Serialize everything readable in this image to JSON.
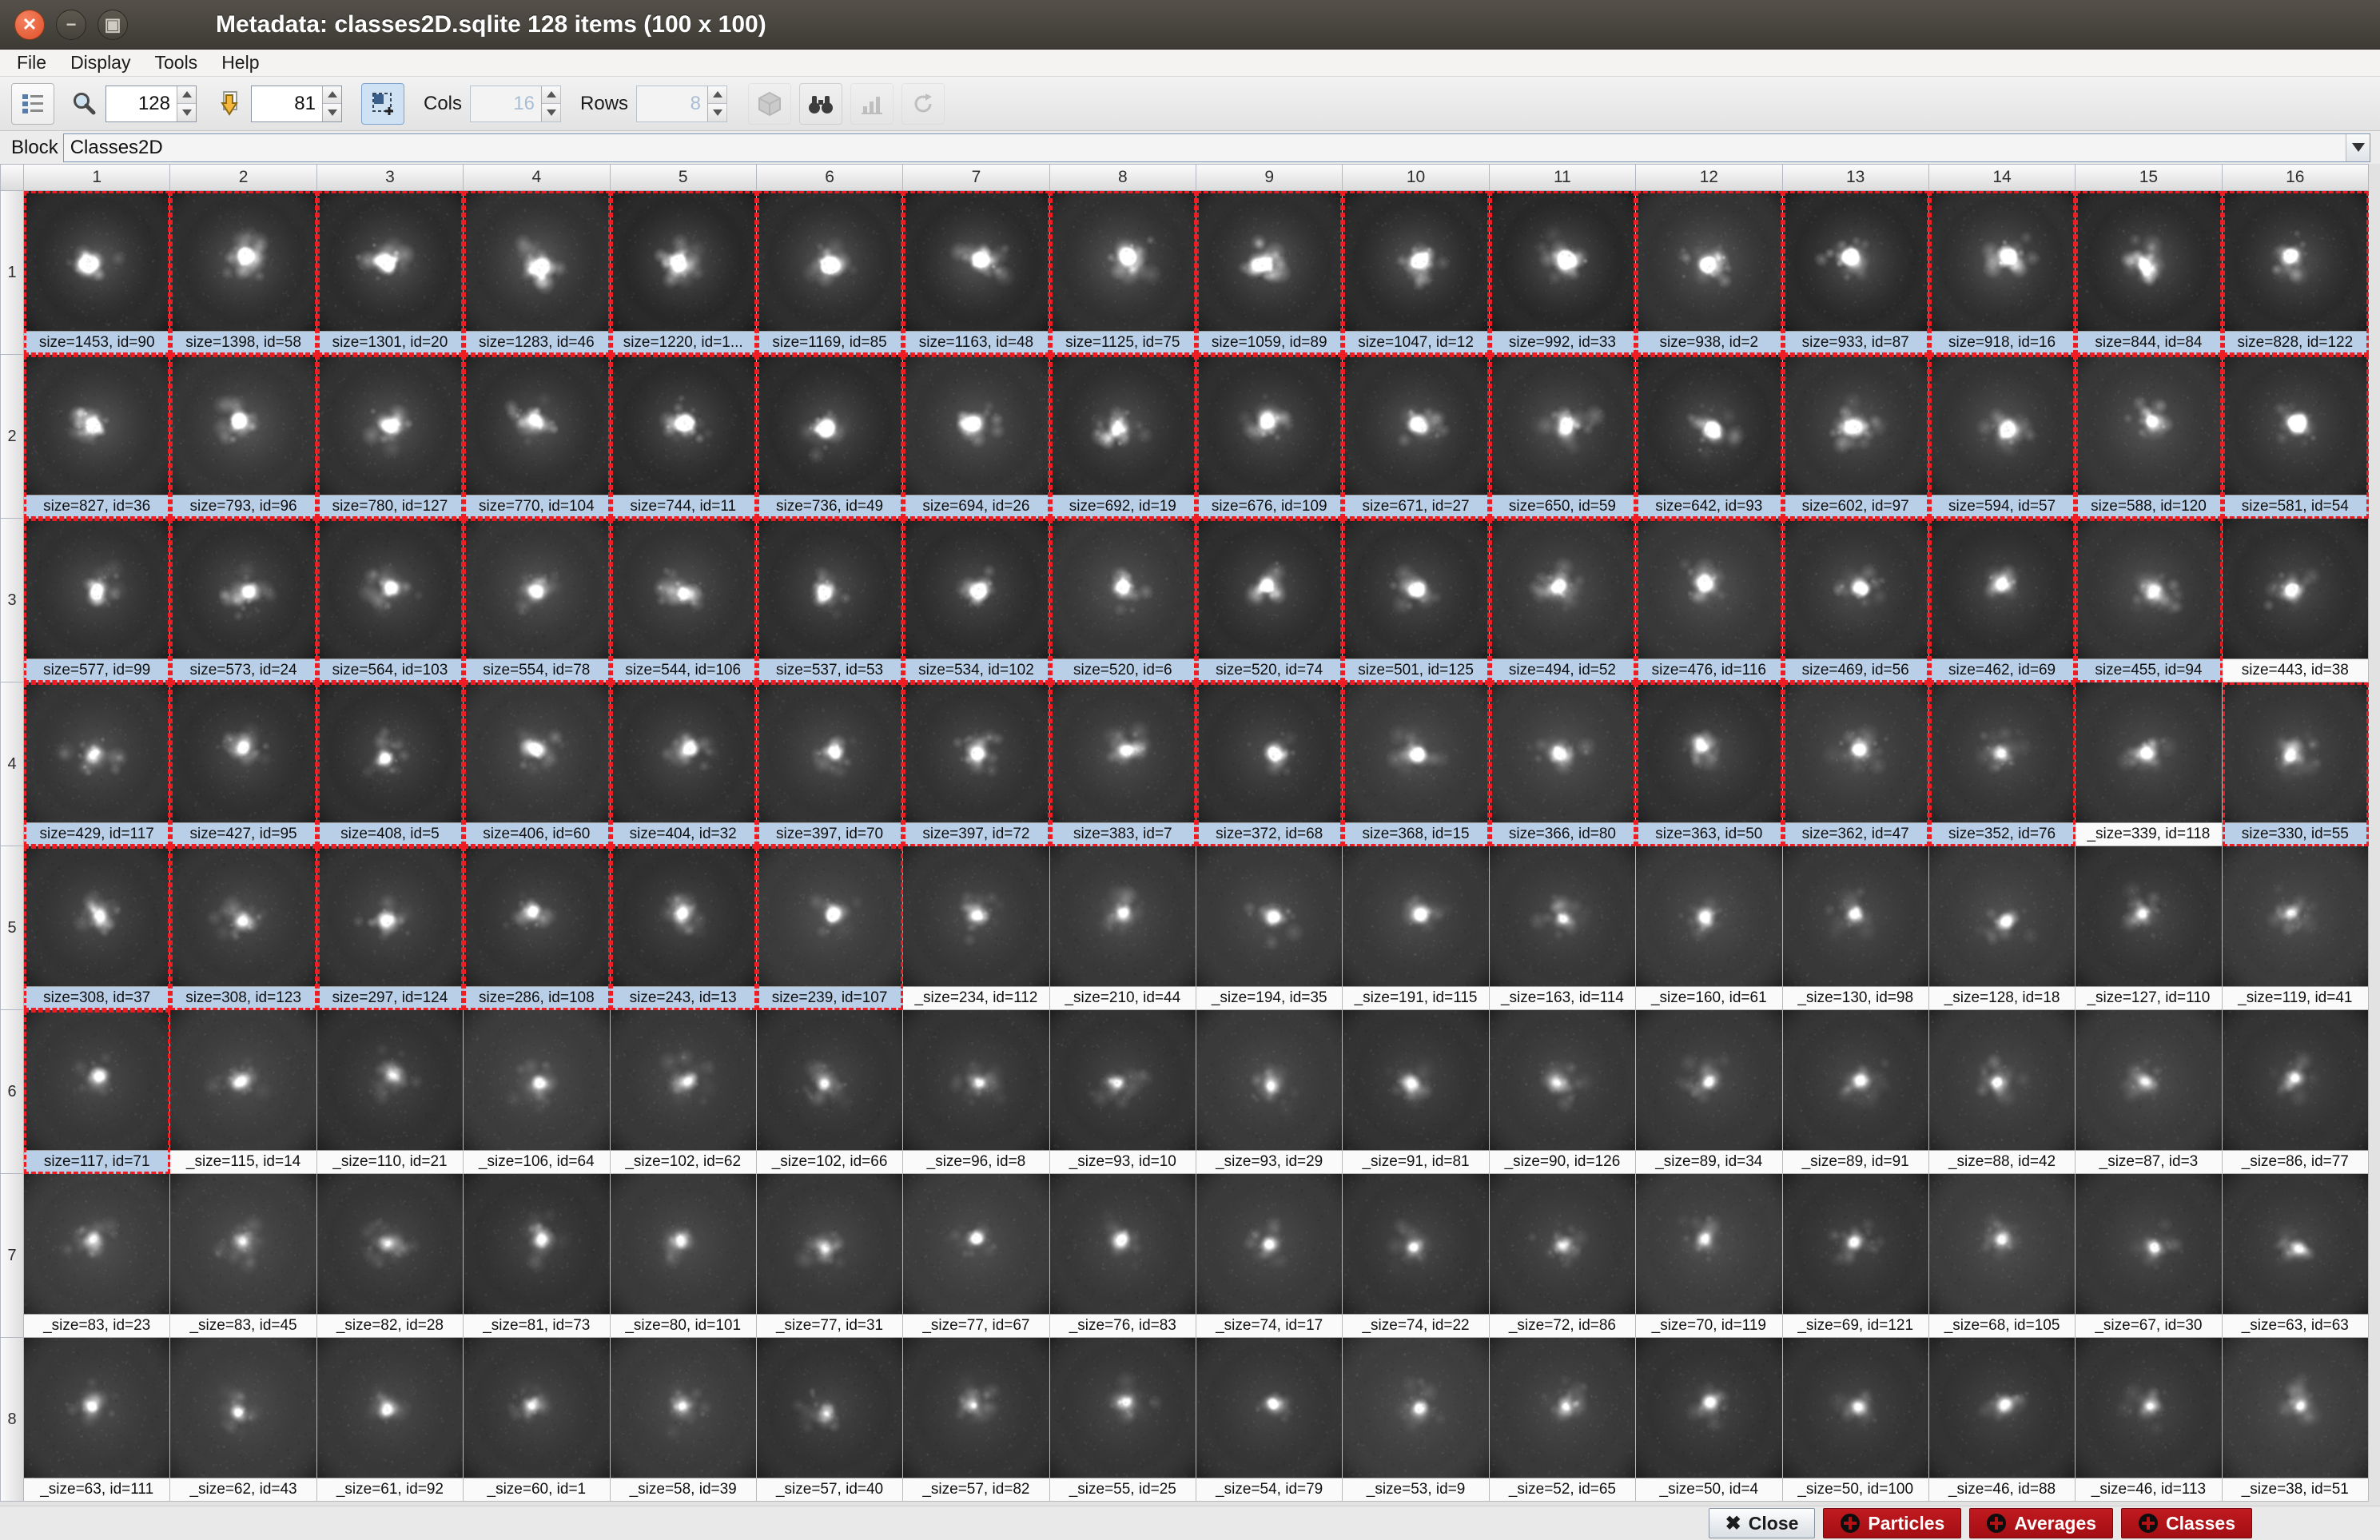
{
  "window": {
    "title": "Metadata: classes2D.sqlite 128 items (100 x 100)",
    "controls": {
      "close": "close-window",
      "minimize": "minimize-window",
      "maximize": "maximize-window"
    }
  },
  "menu": {
    "items": [
      "File",
      "Display",
      "Tools",
      "Help"
    ]
  },
  "toolbar": {
    "zoom_value": "128",
    "goto_value": "81",
    "cols_label": "Cols",
    "cols_value": "16",
    "rows_label": "Rows",
    "rows_value": "8",
    "icons": [
      "columns-list-icon",
      "magnifier-icon",
      "goto-item-icon",
      "auto-adjust-icon",
      "cube-icon",
      "binoculars-icon",
      "bar-chart-icon",
      "rotate-icon"
    ]
  },
  "block": {
    "label": "Block",
    "value": "Classes2D"
  },
  "grid": {
    "col_headers": [
      "1",
      "2",
      "3",
      "4",
      "5",
      "6",
      "7",
      "8",
      "9",
      "10",
      "11",
      "12",
      "13",
      "14",
      "15",
      "16"
    ],
    "row_headers": [
      "1",
      "2",
      "3",
      "4",
      "5",
      "6",
      "7",
      "8"
    ],
    "cells": [
      {
        "label": "size=1453, id=90",
        "sel": true
      },
      {
        "label": "size=1398, id=58",
        "sel": true
      },
      {
        "label": "size=1301, id=20",
        "sel": true
      },
      {
        "label": "size=1283, id=46",
        "sel": true
      },
      {
        "label": "size=1220, id=1...",
        "sel": true
      },
      {
        "label": "size=1169, id=85",
        "sel": true
      },
      {
        "label": "size=1163, id=48",
        "sel": true
      },
      {
        "label": "size=1125, id=75",
        "sel": true
      },
      {
        "label": "size=1059, id=89",
        "sel": true
      },
      {
        "label": "size=1047, id=12",
        "sel": true
      },
      {
        "label": "size=992, id=33",
        "sel": true
      },
      {
        "label": "size=938, id=2",
        "sel": true
      },
      {
        "label": "size=933, id=87",
        "sel": true
      },
      {
        "label": "size=918, id=16",
        "sel": true
      },
      {
        "label": "size=844, id=84",
        "sel": true
      },
      {
        "label": "size=828, id=122",
        "sel": true
      },
      {
        "label": "size=827, id=36",
        "sel": true
      },
      {
        "label": "size=793, id=96",
        "sel": true
      },
      {
        "label": "size=780, id=127",
        "sel": true
      },
      {
        "label": "size=770, id=104",
        "sel": true
      },
      {
        "label": "size=744, id=11",
        "sel": true
      },
      {
        "label": "size=736, id=49",
        "sel": true
      },
      {
        "label": "size=694, id=26",
        "sel": true
      },
      {
        "label": "size=692, id=19",
        "sel": true
      },
      {
        "label": "size=676, id=109",
        "sel": true
      },
      {
        "label": "size=671, id=27",
        "sel": true
      },
      {
        "label": "size=650, id=59",
        "sel": true
      },
      {
        "label": "size=642, id=93",
        "sel": true
      },
      {
        "label": "size=602, id=97",
        "sel": true
      },
      {
        "label": "size=594, id=57",
        "sel": true
      },
      {
        "label": "size=588, id=120",
        "sel": true
      },
      {
        "label": "size=581, id=54",
        "sel": true
      },
      {
        "label": "size=577, id=99",
        "sel": true
      },
      {
        "label": "size=573, id=24",
        "sel": true
      },
      {
        "label": "size=564, id=103",
        "sel": true
      },
      {
        "label": "size=554, id=78",
        "sel": true
      },
      {
        "label": "size=544, id=106",
        "sel": true
      },
      {
        "label": "size=537, id=53",
        "sel": true
      },
      {
        "label": "size=534, id=102",
        "sel": true
      },
      {
        "label": "size=520, id=6",
        "sel": true
      },
      {
        "label": "size=520, id=74",
        "sel": true
      },
      {
        "label": "size=501, id=125",
        "sel": true
      },
      {
        "label": "size=494, id=52",
        "sel": true
      },
      {
        "label": "size=476, id=116",
        "sel": true
      },
      {
        "label": "size=469, id=56",
        "sel": true
      },
      {
        "label": "size=462, id=69",
        "sel": true
      },
      {
        "label": "size=455, id=94",
        "sel": true
      },
      {
        "label": "size=443, id=38",
        "sel": false
      },
      {
        "label": "size=429, id=117",
        "sel": true
      },
      {
        "label": "size=427, id=95",
        "sel": true
      },
      {
        "label": "size=408, id=5",
        "sel": true
      },
      {
        "label": "size=406, id=60",
        "sel": true
      },
      {
        "label": "size=404, id=32",
        "sel": true
      },
      {
        "label": "size=397, id=70",
        "sel": true
      },
      {
        "label": "size=397, id=72",
        "sel": true
      },
      {
        "label": "size=383, id=7",
        "sel": true
      },
      {
        "label": "size=372, id=68",
        "sel": true
      },
      {
        "label": "size=368, id=15",
        "sel": true
      },
      {
        "label": "size=366, id=80",
        "sel": true
      },
      {
        "label": "size=363, id=50",
        "sel": true
      },
      {
        "label": "size=362, id=47",
        "sel": true
      },
      {
        "label": "size=352, id=76",
        "sel": true
      },
      {
        "label": "_size=339, id=118",
        "sel": false
      },
      {
        "label": "size=330, id=55",
        "sel": true
      },
      {
        "label": "size=308, id=37",
        "sel": true
      },
      {
        "label": "size=308, id=123",
        "sel": true
      },
      {
        "label": "size=297, id=124",
        "sel": true
      },
      {
        "label": "size=286, id=108",
        "sel": true
      },
      {
        "label": "size=243, id=13",
        "sel": true
      },
      {
        "label": "size=239, id=107",
        "sel": true
      },
      {
        "label": "_size=234, id=112",
        "sel": false
      },
      {
        "label": "_size=210, id=44",
        "sel": false
      },
      {
        "label": "_size=194, id=35",
        "sel": false
      },
      {
        "label": "_size=191, id=115",
        "sel": false
      },
      {
        "label": "_size=163, id=114",
        "sel": false
      },
      {
        "label": "_size=160, id=61",
        "sel": false
      },
      {
        "label": "_size=130, id=98",
        "sel": false
      },
      {
        "label": "_size=128, id=18",
        "sel": false
      },
      {
        "label": "_size=127, id=110",
        "sel": false
      },
      {
        "label": "_size=119, id=41",
        "sel": false
      },
      {
        "label": "size=117, id=71",
        "sel": true
      },
      {
        "label": "_size=115, id=14",
        "sel": false
      },
      {
        "label": "_size=110, id=21",
        "sel": false
      },
      {
        "label": "_size=106, id=64",
        "sel": false
      },
      {
        "label": "_size=102, id=62",
        "sel": false
      },
      {
        "label": "_size=102, id=66",
        "sel": false
      },
      {
        "label": "_size=96, id=8",
        "sel": false
      },
      {
        "label": "_size=93, id=10",
        "sel": false
      },
      {
        "label": "_size=93, id=29",
        "sel": false
      },
      {
        "label": "_size=91, id=81",
        "sel": false
      },
      {
        "label": "_size=90, id=126",
        "sel": false
      },
      {
        "label": "_size=89, id=34",
        "sel": false
      },
      {
        "label": "_size=89, id=91",
        "sel": false
      },
      {
        "label": "_size=88, id=42",
        "sel": false
      },
      {
        "label": "_size=87, id=3",
        "sel": false
      },
      {
        "label": "_size=86, id=77",
        "sel": false
      },
      {
        "label": "_size=83, id=23",
        "sel": false
      },
      {
        "label": "_size=83, id=45",
        "sel": false
      },
      {
        "label": "_size=82, id=28",
        "sel": false
      },
      {
        "label": "_size=81, id=73",
        "sel": false
      },
      {
        "label": "_size=80, id=101",
        "sel": false
      },
      {
        "label": "_size=77, id=31",
        "sel": false
      },
      {
        "label": "_size=77, id=67",
        "sel": false
      },
      {
        "label": "_size=76, id=83",
        "sel": false
      },
      {
        "label": "_size=74, id=17",
        "sel": false
      },
      {
        "label": "_size=74, id=22",
        "sel": false
      },
      {
        "label": "_size=72, id=86",
        "sel": false
      },
      {
        "label": "_size=70, id=119",
        "sel": false
      },
      {
        "label": "_size=69, id=121",
        "sel": false
      },
      {
        "label": "_size=68, id=105",
        "sel": false
      },
      {
        "label": "_size=67, id=30",
        "sel": false
      },
      {
        "label": "_size=63, id=63",
        "sel": false
      },
      {
        "label": "_size=63, id=111",
        "sel": false
      },
      {
        "label": "_size=62, id=43",
        "sel": false
      },
      {
        "label": "_size=61, id=92",
        "sel": false
      },
      {
        "label": "_size=60, id=1",
        "sel": false
      },
      {
        "label": "_size=58, id=39",
        "sel": false
      },
      {
        "label": "_size=57, id=40",
        "sel": false
      },
      {
        "label": "_size=57, id=82",
        "sel": false
      },
      {
        "label": "_size=55, id=25",
        "sel": false
      },
      {
        "label": "_size=54, id=79",
        "sel": false
      },
      {
        "label": "_size=53, id=9",
        "sel": false
      },
      {
        "label": "_size=52, id=65",
        "sel": false
      },
      {
        "label": "_size=50, id=4",
        "sel": false
      },
      {
        "label": "_size=50, id=100",
        "sel": false
      },
      {
        "label": "_size=46, id=88",
        "sel": false
      },
      {
        "label": "_size=46, id=113",
        "sel": false
      },
      {
        "label": "_size=38, id=51",
        "sel": false
      }
    ]
  },
  "statusbar": {
    "close_label": "Close",
    "particles_label": "Particles",
    "averages_label": "Averages",
    "classes_label": "Classes"
  },
  "colors": {
    "selection_label_bg": "#b9cee7",
    "selection_border": "#ee1d23",
    "action_button_red": "#b01216",
    "titlebar_bg": "#46423b",
    "close_button_orange": "#e95420"
  }
}
